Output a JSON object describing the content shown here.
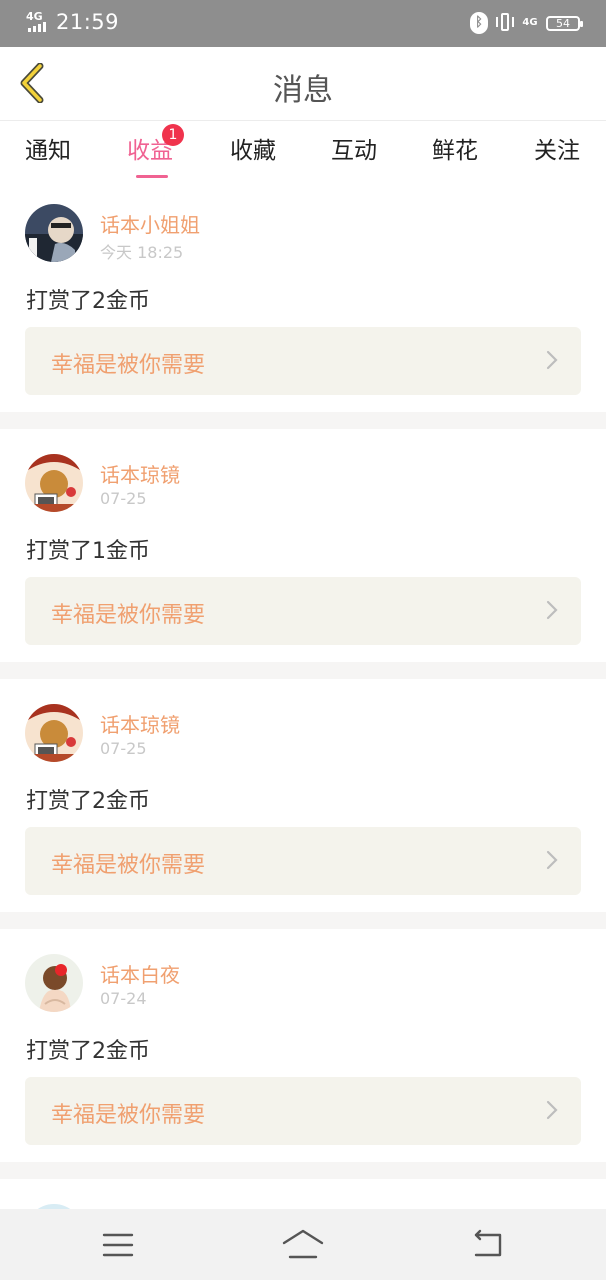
{
  "status_bar": {
    "network_left": "4G",
    "time": "21:59",
    "network_right": "4G",
    "battery": "54"
  },
  "header": {
    "title": "消息"
  },
  "tabs": [
    {
      "label": "通知",
      "active": false
    },
    {
      "label": "收益",
      "active": true,
      "badge": "1"
    },
    {
      "label": "收藏",
      "active": false
    },
    {
      "label": "互动",
      "active": false
    },
    {
      "label": "鲜花",
      "active": false
    },
    {
      "label": "关注",
      "active": false
    }
  ],
  "messages": [
    {
      "user": "话本小姐姐",
      "time": "今天 18:25",
      "text": "打赏了2金币",
      "work": "幸福是被你需要"
    },
    {
      "user": "话本琼镜",
      "time": "07-25",
      "text": "打赏了1金币",
      "work": "幸福是被你需要"
    },
    {
      "user": "话本琼镜",
      "time": "07-25",
      "text": "打赏了2金币",
      "work": "幸福是被你需要"
    },
    {
      "user": "话本白夜",
      "time": "07-24",
      "text": "打赏了2金币",
      "work": "幸福是被你需要"
    }
  ],
  "colors": {
    "accent": "#f06292",
    "name": "#f0a070",
    "badge": "#f0334d",
    "status_bar": "#8e8e8e"
  },
  "icons": [
    "back-arrow-icon",
    "bluetooth-icon",
    "vibrate-icon",
    "battery-icon",
    "chevron-right-icon",
    "menu-icon",
    "home-icon",
    "back-icon"
  ]
}
